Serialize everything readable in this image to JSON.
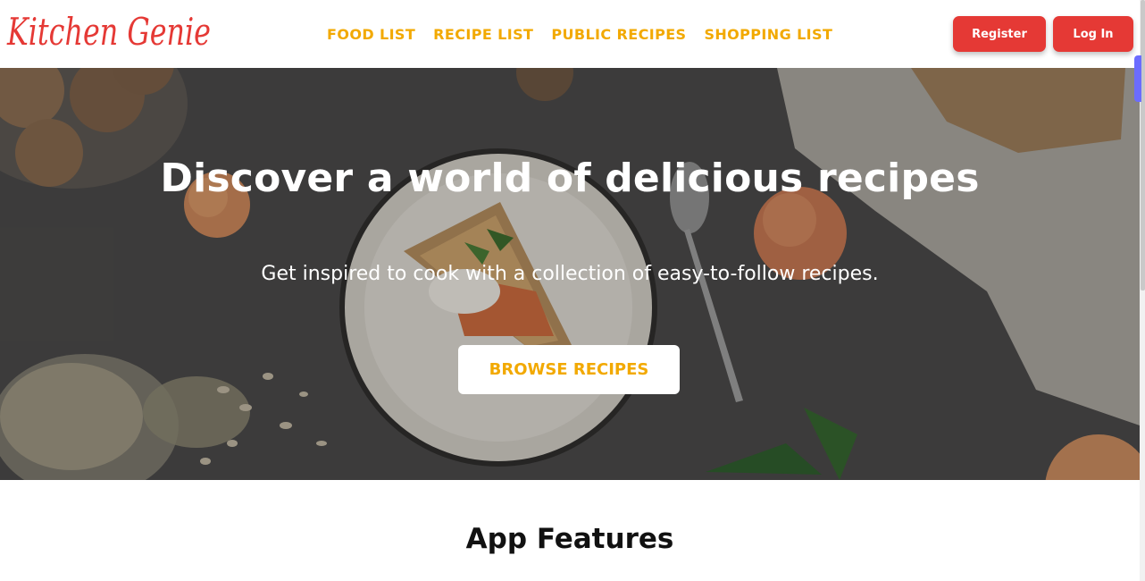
{
  "header": {
    "logo_text": "Kitchen Genie",
    "nav": [
      "FOOD LIST",
      "RECIPE LIST",
      "PUBLIC RECIPES",
      "SHOPPING LIST"
    ],
    "register_label": "Register",
    "login_label": "Log In"
  },
  "hero": {
    "title": "Discover a world of delicious recipes",
    "subtitle": "Get inspired to cook with a collection of easy-to-follow recipes.",
    "cta_label": "BROWSE RECIPES"
  },
  "features": {
    "title": "App Features"
  },
  "colors": {
    "accent": "#f2a900",
    "brand_red": "#e53935"
  }
}
